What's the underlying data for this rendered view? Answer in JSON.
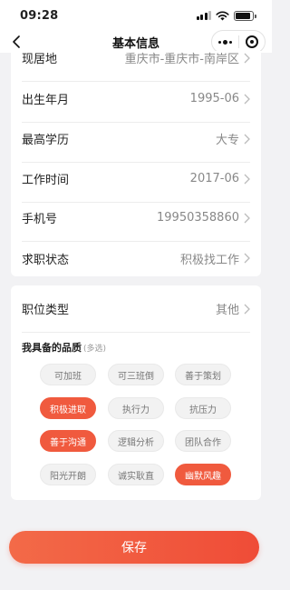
{
  "status": {
    "time": "09:28"
  },
  "nav": {
    "title": "基本信息"
  },
  "fields": [
    {
      "label": "现居地",
      "value": "重庆市-重庆市-南岸区"
    },
    {
      "label": "出生年月",
      "value": "1995-06"
    },
    {
      "label": "最高学历",
      "value": "大专"
    },
    {
      "label": "工作时间",
      "value": "2017-06"
    },
    {
      "label": "手机号",
      "value": "19950358860"
    },
    {
      "label": "求职状态",
      "value": "积极找工作"
    }
  ],
  "job_type": {
    "label": "职位类型",
    "value": "其他"
  },
  "qualities": {
    "title": "我具备的品质",
    "hint": "(多选)",
    "tags": [
      {
        "label": "可加班",
        "selected": false
      },
      {
        "label": "可三班倒",
        "selected": false
      },
      {
        "label": "善于策划",
        "selected": false
      },
      {
        "label": "积极进取",
        "selected": true
      },
      {
        "label": "执行力",
        "selected": false
      },
      {
        "label": "抗压力",
        "selected": false
      },
      {
        "label": "善于沟通",
        "selected": true
      },
      {
        "label": "逻辑分析",
        "selected": false
      },
      {
        "label": "团队合作",
        "selected": false
      },
      {
        "label": "阳光开朗",
        "selected": false
      },
      {
        "label": "诚实耿直",
        "selected": false
      },
      {
        "label": "幽默风趣",
        "selected": true
      }
    ]
  },
  "save_button": {
    "label": "保存"
  },
  "colors": {
    "accent": "#f05a3e",
    "background": "#f2f2f4"
  },
  "icons": {
    "back": "chevron-left-icon",
    "more": "more-dots-icon",
    "close": "target-circle-icon",
    "row_arrow": "chevron-right-icon"
  }
}
